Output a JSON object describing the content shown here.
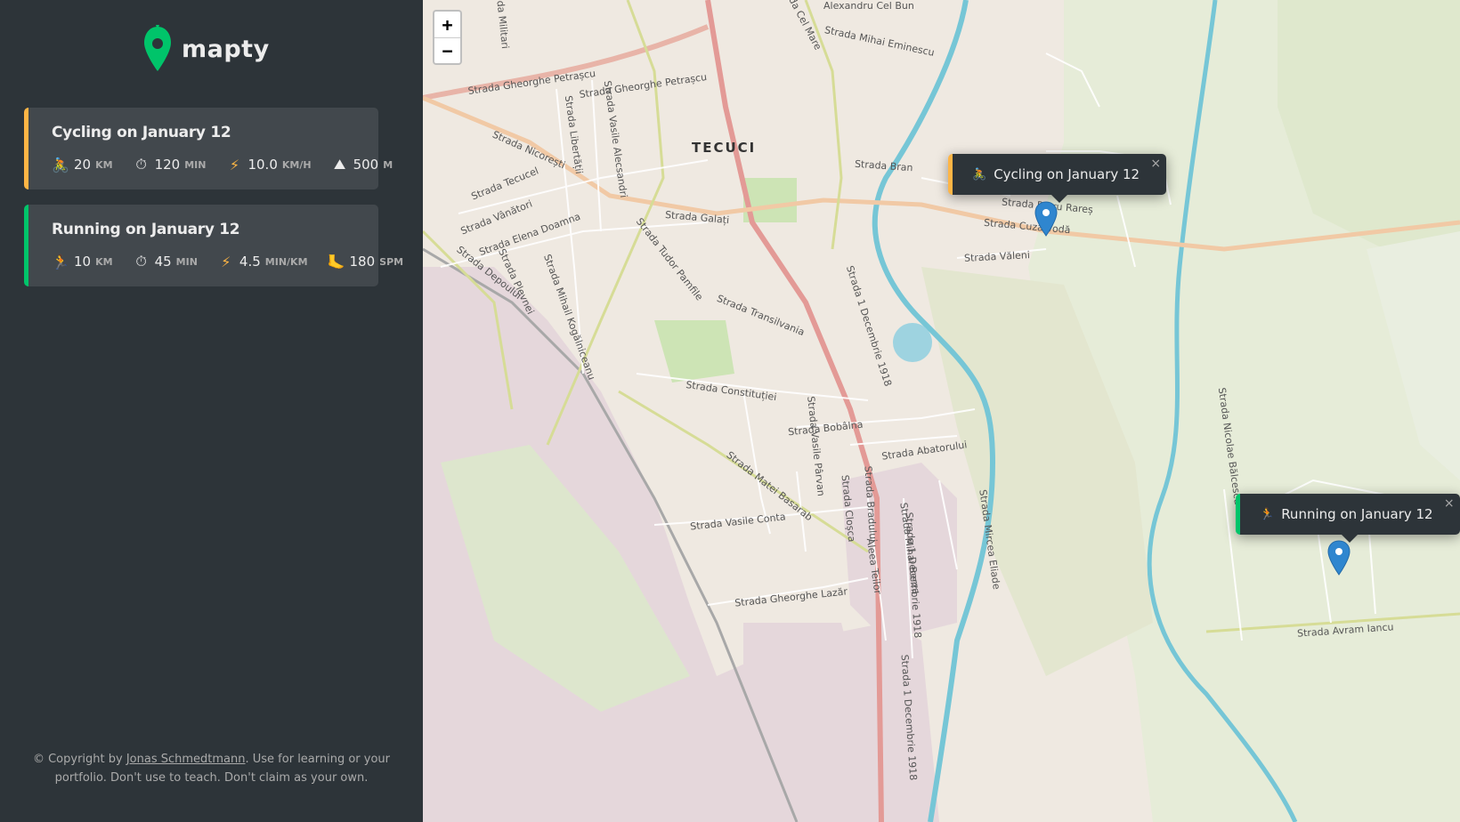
{
  "app": {
    "name": "mapty"
  },
  "workouts": [
    {
      "type": "cycling",
      "title": "Cycling on January 12",
      "details": [
        {
          "icon": "🚴",
          "icon_name": "cycling-icon",
          "value": "20",
          "unit": "km"
        },
        {
          "icon": "⏱",
          "icon_name": "stopwatch-icon",
          "value": "120",
          "unit": "min"
        },
        {
          "icon": "⚡",
          "icon_name": "lightning-icon",
          "value": "10.0",
          "unit": "km/h"
        },
        {
          "icon": "⛰",
          "icon_name": "mountain-icon",
          "value": "500",
          "unit": "m"
        }
      ]
    },
    {
      "type": "running",
      "title": "Running on January 12",
      "details": [
        {
          "icon": "🏃",
          "icon_name": "running-icon",
          "value": "10",
          "unit": "km"
        },
        {
          "icon": "⏱",
          "icon_name": "stopwatch-icon",
          "value": "45",
          "unit": "min"
        },
        {
          "icon": "⚡",
          "icon_name": "lightning-icon",
          "value": "4.5",
          "unit": "min/km"
        },
        {
          "icon": "🦶",
          "icon_name": "footprint-icon",
          "value": "180",
          "unit": "spm"
        }
      ]
    }
  ],
  "copyright": {
    "prefix": "© Copyright by ",
    "author": "Jonas Schmedtmann",
    "suffix": ". Use for learning or your portfolio. Don't use to teach. Don't claim as your own."
  },
  "map": {
    "zoom_in": "+",
    "zoom_out": "−",
    "popups": [
      {
        "type": "cycling",
        "icon": "🚴",
        "label": "Cycling on January 12",
        "close": "×"
      },
      {
        "type": "running",
        "icon": "🏃",
        "label": "Running on January 12",
        "close": "×"
      }
    ],
    "city": "TECUCI",
    "streets": [
      "Strada Gheorghe Petrașcu",
      "Strada Libertății",
      "Strada Vasile Alecsandri",
      "Strada Nicorești",
      "Strada Tecucel",
      "Strada Vânători",
      "Strada Elena Doamna",
      "Strada Depoului",
      "Strada Plevnei",
      "Strada Mihail Kogălniceanu",
      "Strada Galați",
      "Strada Tudor Pamfile",
      "Strada Transilvania",
      "Strada Constituției",
      "Strada Bobâlna",
      "Strada Abatorului",
      "Strada Matei Basarab",
      "Strada Vasile Conta",
      "Strada Vasile Pârvan",
      "Strada Cloșca",
      "Strada Bradului",
      "Strada Gheorghe Lazăr",
      "Strada 1 Decembrie 1918",
      "Strada Mihai Eminescu",
      "Strada Bran",
      "Strada Cuza Vodă",
      "Strada Petru Rareș",
      "Strada Văleni",
      "Strada Mircea Eliade",
      "Strada Mihai Berza",
      "Aleea Teilor",
      "Strada Nicolae Bălcescu",
      "Strada Avram Iancu",
      "Strada Militari",
      "Strada Cel Mare",
      "Alexandru Cel Bun"
    ]
  }
}
